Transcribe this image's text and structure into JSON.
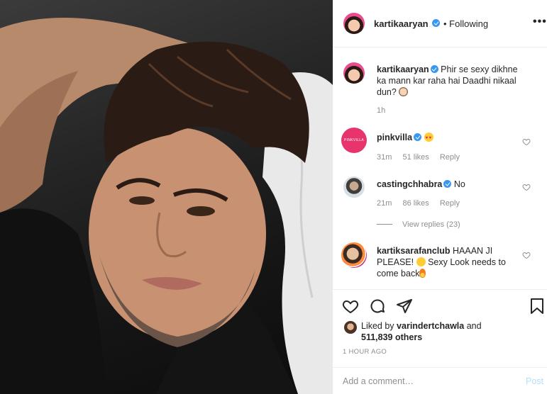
{
  "header": {
    "username": "kartikaaryan",
    "follow_status": "• Following",
    "more_icon": "more-icon",
    "more_glyph": "•••"
  },
  "caption": {
    "username": "kartikaaryan",
    "text": "Phir se sexy dikhne ka mann kar raha hai Daadhi nikaal dun?",
    "time": "1h"
  },
  "comments": [
    {
      "username": "pinkvilla",
      "text": "",
      "avatar_text": "PINKVILLA",
      "time": "31m",
      "likes": "51 likes",
      "reply": "Reply"
    },
    {
      "username": "castingchhabra",
      "text": "No",
      "time": "21m",
      "likes": "86 likes",
      "reply": "Reply"
    },
    {
      "username": "kartiksarafanclub",
      "text_1": "HAAAN JI PLEASE!",
      "text_2": "Sexy Look needs to come back"
    }
  ],
  "view_replies": "View replies (23)",
  "actions": {
    "like_icon": "heart-icon",
    "comment_icon": "comment-icon",
    "share_icon": "share-icon",
    "save_icon": "bookmark-icon"
  },
  "likes": {
    "prefix": "Liked by",
    "user": "varindertchawla",
    "conj": "and",
    "count": "511,839 others"
  },
  "timeago": "1 HOUR AGO",
  "add_comment": {
    "placeholder": "Add a comment…",
    "post_label": "Post"
  },
  "colors": {
    "verified": "#3897f0",
    "post_disabled": "#b2dffc",
    "muted": "#8e8e8e"
  }
}
